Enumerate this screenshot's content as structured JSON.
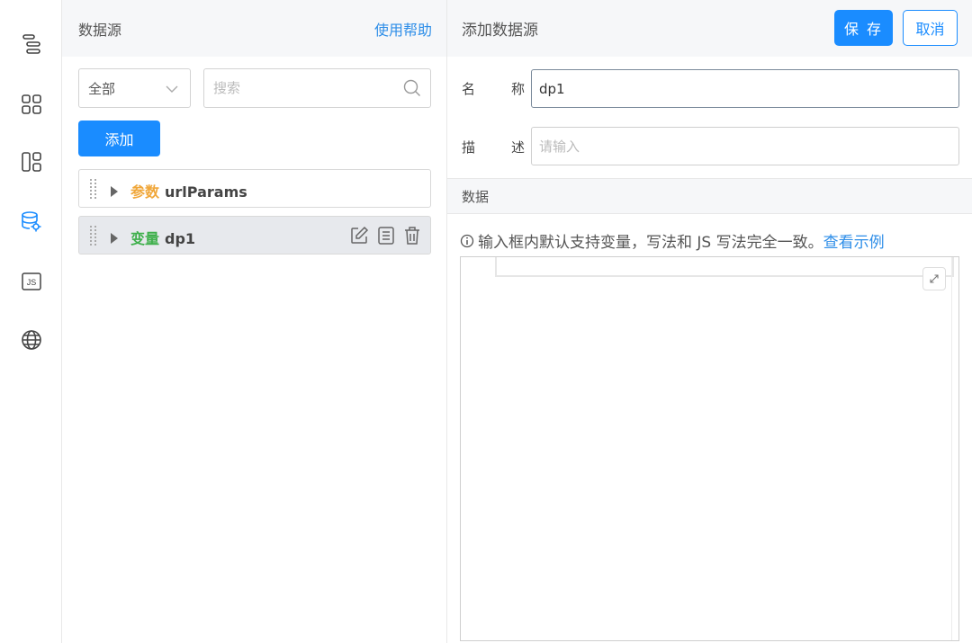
{
  "rail": {
    "icons": [
      "outline-icon",
      "components-icon",
      "layout-icon",
      "datasource-icon",
      "js-icon",
      "globe-icon"
    ],
    "active_color": "#1a8cff"
  },
  "datasource_panel": {
    "title": "数据源",
    "help_label": "使用帮助",
    "filter": {
      "selected": "全部"
    },
    "search": {
      "placeholder": "搜索"
    },
    "add_label": "添加",
    "items": [
      {
        "type_label": "参数",
        "name": "urlParams",
        "type_color": "#f0a73a",
        "active": false
      },
      {
        "type_label": "变量",
        "name": "dp1",
        "type_color": "#3fb04c",
        "active": true
      }
    ]
  },
  "editor": {
    "title": "添加数据源",
    "save_label": "保 存",
    "cancel_label": "取消",
    "name_label": [
      "名",
      "称"
    ],
    "name_value": "dp1",
    "desc_label": [
      "描",
      "述"
    ],
    "desc_placeholder": "请输入",
    "section_label": "数据",
    "hint_text": "输入框内默认支持变量，写法和 JS 写法完全一致。",
    "hint_link": "查看示例"
  },
  "colors": {
    "primary": "#1a8cff",
    "link": "#2e8ee8"
  }
}
